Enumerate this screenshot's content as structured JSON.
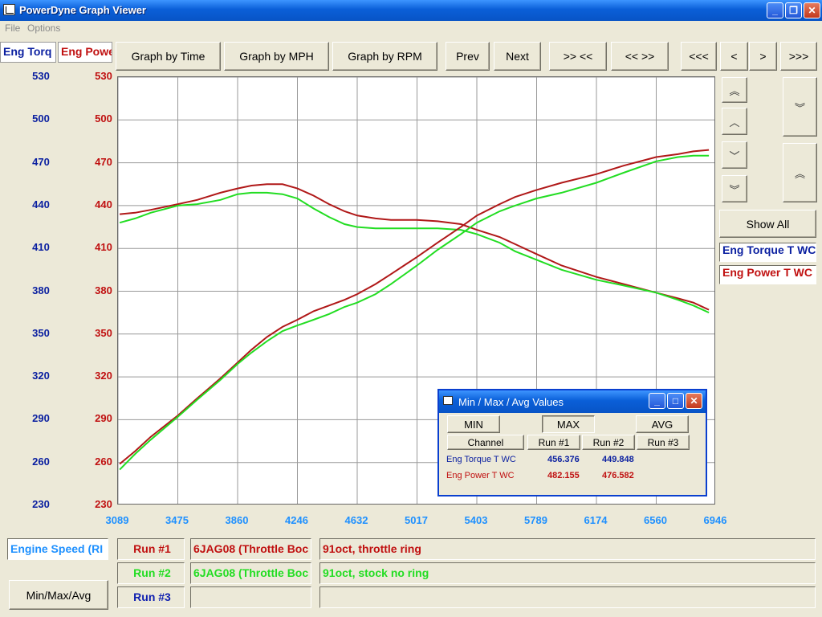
{
  "window": {
    "title": "PowerDyne Graph Viewer"
  },
  "menu": {
    "file": "File",
    "options": "Options"
  },
  "tabs": {
    "torque": "Eng Torq",
    "power": "Eng Powe"
  },
  "toolbar": {
    "time": "Graph by Time",
    "mph": "Graph by MPH",
    "rpm": "Graph by RPM",
    "prev": "Prev",
    "next": "Next",
    "zoom_in": ">> <<",
    "zoom_out": "<< >>",
    "far_left": "<<<",
    "left": "<",
    "right": ">",
    "far_right": ">>>"
  },
  "side": {
    "show_all": "Show All",
    "torque_label": "Eng Torque T WC",
    "power_label": "Eng Power T WC"
  },
  "colors": {
    "torque_axis": "#0a1fa0",
    "power_axis": "#c01010",
    "run1": "#b01818",
    "run2": "#22dd22",
    "run3": "#1020b0",
    "xaxis": "#1e90ff"
  },
  "bottom": {
    "x_channel": "Engine Speed (RI",
    "minmax_button": "Min/Max/Avg",
    "runs": [
      {
        "label": "Run #1",
        "file": "6JAG08 (Throttle Boc",
        "note": "91oct, throttle ring"
      },
      {
        "label": "Run #2",
        "file": "6JAG08 (Throttle Boc",
        "note": "91oct, stock no ring"
      },
      {
        "label": "Run #3",
        "file": "",
        "note": ""
      }
    ]
  },
  "minmax_dialog": {
    "title": "Min / Max / Avg Values",
    "min": "MIN",
    "max": "MAX",
    "avg": "AVG",
    "headers": [
      "Channel",
      "Run #1",
      "Run #2",
      "Run #3"
    ],
    "rows": [
      {
        "channel": "Eng Torque T WC",
        "run1": "456.376",
        "run2": "449.848",
        "run3": ""
      },
      {
        "channel": "Eng Power T WC",
        "run1": "482.155",
        "run2": "476.582",
        "run3": ""
      }
    ]
  },
  "chart_data": {
    "type": "line",
    "x_ticks": [
      "3089",
      "3475",
      "3860",
      "4246",
      "4632",
      "5017",
      "5403",
      "5789",
      "6174",
      "6560",
      "6946"
    ],
    "xlim": [
      3089,
      6946
    ],
    "y_ticks_torque": [
      "530",
      "500",
      "470",
      "440",
      "410",
      "380",
      "350",
      "320",
      "290",
      "260",
      "230"
    ],
    "y_ticks_power": [
      "530",
      "500",
      "470",
      "440",
      "410",
      "380",
      "350",
      "320",
      "290",
      "260",
      "230"
    ],
    "ylim": [
      230,
      530
    ],
    "grid": true,
    "series": [
      {
        "name": "Eng Torque T WC",
        "run": "Run #1",
        "color": "#b01818",
        "x": [
          3100,
          3200,
          3300,
          3475,
          3600,
          3750,
          3860,
          3950,
          4050,
          4150,
          4246,
          4350,
          4450,
          4550,
          4632,
          4750,
          4850,
          5017,
          5150,
          5300,
          5403,
          5550,
          5650,
          5789,
          5950,
          6174,
          6350,
          6560,
          6700,
          6800,
          6900
        ],
        "y": [
          434,
          435,
          437,
          441,
          444,
          449,
          452,
          454,
          455,
          455,
          452,
          447,
          441,
          436,
          433,
          431,
          430,
          430,
          429,
          427,
          423,
          418,
          413,
          406,
          398,
          390,
          385,
          379,
          375,
          372,
          367
        ]
      },
      {
        "name": "Eng Torque T WC",
        "run": "Run #2",
        "color": "#22dd22",
        "x": [
          3100,
          3200,
          3300,
          3475,
          3600,
          3750,
          3860,
          3950,
          4050,
          4150,
          4246,
          4350,
          4450,
          4550,
          4632,
          4750,
          4850,
          5017,
          5150,
          5300,
          5403,
          5550,
          5650,
          5789,
          5950,
          6174,
          6350,
          6560,
          6700,
          6800,
          6900
        ],
        "y": [
          428,
          431,
          435,
          440,
          441,
          444,
          448,
          449,
          449,
          448,
          445,
          438,
          432,
          427,
          425,
          424,
          424,
          424,
          424,
          423,
          420,
          414,
          408,
          402,
          395,
          388,
          384,
          379,
          374,
          370,
          365
        ]
      },
      {
        "name": "Eng Power T WC",
        "run": "Run #1",
        "color": "#b01818",
        "x": [
          3100,
          3200,
          3300,
          3475,
          3600,
          3750,
          3860,
          3950,
          4050,
          4150,
          4246,
          4350,
          4450,
          4550,
          4632,
          4750,
          4850,
          5017,
          5150,
          5300,
          5403,
          5550,
          5650,
          5789,
          5950,
          6174,
          6350,
          6560,
          6700,
          6800,
          6900
        ],
        "y": [
          259,
          268,
          278,
          293,
          305,
          319,
          330,
          339,
          348,
          355,
          360,
          366,
          370,
          374,
          378,
          385,
          392,
          404,
          414,
          425,
          433,
          441,
          446,
          451,
          456,
          462,
          468,
          474,
          476,
          478,
          479
        ]
      },
      {
        "name": "Eng Power T WC",
        "run": "Run #2",
        "color": "#22dd22",
        "x": [
          3100,
          3200,
          3300,
          3475,
          3600,
          3750,
          3860,
          3950,
          4050,
          4150,
          4246,
          4350,
          4450,
          4550,
          4632,
          4750,
          4850,
          5017,
          5150,
          5300,
          5403,
          5550,
          5650,
          5789,
          5950,
          6174,
          6350,
          6560,
          6700,
          6800,
          6900
        ],
        "y": [
          255,
          266,
          276,
          292,
          304,
          318,
          329,
          337,
          345,
          352,
          356,
          360,
          364,
          369,
          372,
          378,
          385,
          398,
          409,
          420,
          428,
          436,
          440,
          445,
          449,
          456,
          463,
          471,
          474,
          475,
          475
        ]
      }
    ]
  }
}
